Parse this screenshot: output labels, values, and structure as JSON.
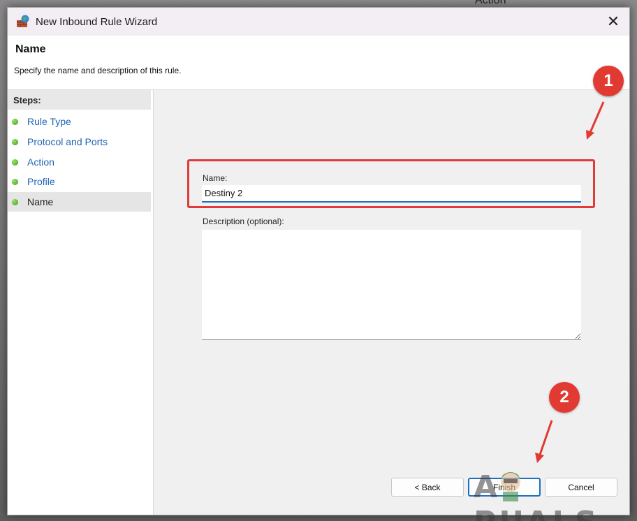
{
  "background": {
    "text": "Action"
  },
  "window": {
    "title": "New Inbound Rule Wizard",
    "close_glyph": "✕"
  },
  "header": {
    "title": "Name",
    "description": "Specify the name and description of this rule."
  },
  "steps": {
    "title": "Steps:",
    "items": [
      {
        "label": "Rule Type"
      },
      {
        "label": "Protocol and Ports"
      },
      {
        "label": "Action"
      },
      {
        "label": "Profile"
      },
      {
        "label": "Name"
      }
    ]
  },
  "form": {
    "name_label": "Name:",
    "name_value": "Destiny 2",
    "description_label": "Description (optional):",
    "description_value": ""
  },
  "buttons": {
    "back": "< Back",
    "finish": "Finish",
    "cancel": "Cancel"
  },
  "annotations": {
    "badge_1": "1",
    "badge_2": "2",
    "color": "#e13a32"
  },
  "watermark": {
    "text": "A PUALS"
  },
  "colors": {
    "link": "#1e63b4",
    "accent": "#1f6fc0",
    "highlight": "#e03a3a",
    "step_dot": "#3a9a1a"
  }
}
